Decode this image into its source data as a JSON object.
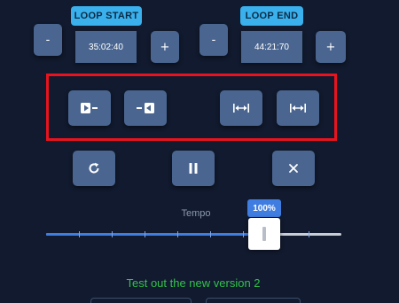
{
  "loop_start": {
    "label": "LOOP START",
    "time": "35:02:40",
    "minus": "-",
    "plus": "+"
  },
  "loop_end": {
    "label": "LOOP END",
    "time": "44:21:70",
    "minus": "-",
    "plus": "+"
  },
  "loop_controls": [
    {
      "icon": "set-start-icon"
    },
    {
      "icon": "set-end-icon"
    },
    {
      "icon": "jump-start-icon"
    },
    {
      "icon": "jump-end-icon"
    }
  ],
  "playback": {
    "loop_icon": "repeat-icon",
    "pause_icon": "pause-icon",
    "close_icon": "close-icon"
  },
  "tempo": {
    "label": "Tempo",
    "value_text": "100%",
    "value_fraction": 0.74
  },
  "promo_text": "Test out the new version 2",
  "colors": {
    "background": "#111a2e",
    "button": "#4a6690",
    "tag": "#3ab1ec",
    "highlight": "#e8131e",
    "slider_fill": "#3f7de0",
    "promo": "#32c24c"
  }
}
